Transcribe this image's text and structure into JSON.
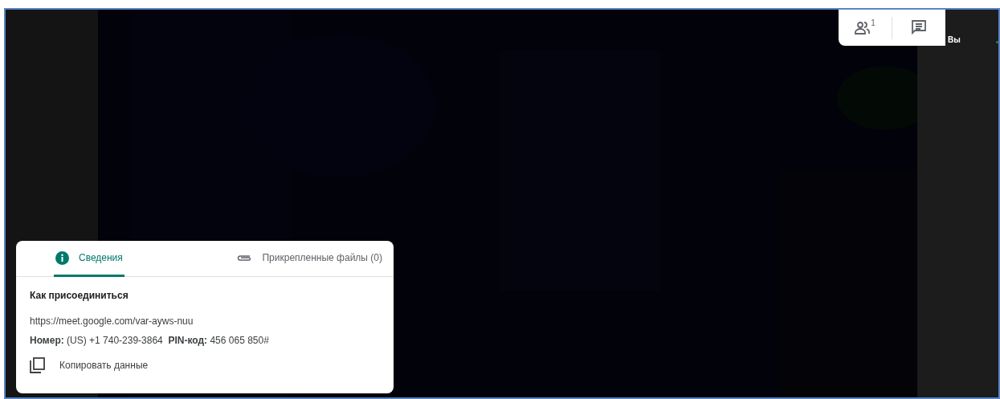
{
  "top_bar": {
    "participants_count": "1",
    "self_label": "Вы"
  },
  "info_panel": {
    "tabs": [
      {
        "label": "Сведения",
        "selected": true
      },
      {
        "label": "Прикрепленные файлы (0)",
        "selected": false
      }
    ],
    "heading": "Как присоединиться",
    "link": "https://meet.google.com/var-ayws-nuu",
    "phone_line": "**Номер:** (US) +1 740-239-3864  **PIN-код:** 456 065 850#",
    "copy_label": "Копировать данные"
  }
}
